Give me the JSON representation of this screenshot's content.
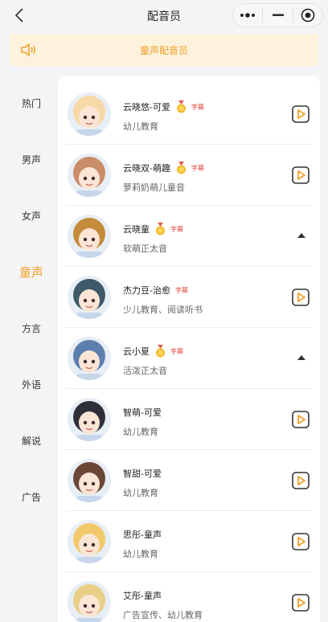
{
  "header": {
    "title": "配音员"
  },
  "banner": {
    "text": "童声配音员",
    "icon": "speaker-icon"
  },
  "sidebar": {
    "categories": [
      {
        "label": "热门"
      },
      {
        "label": "男声"
      },
      {
        "label": "女声"
      },
      {
        "label": "童声",
        "active": true
      },
      {
        "label": "方言"
      },
      {
        "label": "外语"
      },
      {
        "label": "解说"
      },
      {
        "label": "广告"
      }
    ]
  },
  "voices": [
    {
      "name": "云晓悠-可爱",
      "medal": true,
      "subtitle_badge": "字幕",
      "desc": "幼儿教育",
      "action": "play",
      "avatar_color": "#f6d9a6"
    },
    {
      "name": "云晓双-萌趣",
      "medal": true,
      "subtitle_badge": "字幕",
      "desc": "萝莉奶萌儿童音",
      "action": "play",
      "avatar_color": "#c98d68"
    },
    {
      "name": "云晓童",
      "medal": true,
      "subtitle_badge": "字幕",
      "desc": "软萌正太音",
      "action": "collapse",
      "avatar_color": "#c48b3a"
    },
    {
      "name": "杰力豆-治愈",
      "medal": false,
      "subtitle_badge": "字幕",
      "desc": "少儿教育、阅读听书",
      "action": "play",
      "avatar_color": "#3d5a6a"
    },
    {
      "name": "云小夏",
      "medal": true,
      "subtitle_badge": "字幕",
      "desc": "活泼正太音",
      "action": "collapse",
      "avatar_color": "#5d7fae"
    },
    {
      "name": "智萌-可爱",
      "medal": false,
      "subtitle_badge": "",
      "desc": "幼儿教育",
      "action": "play",
      "avatar_color": "#2f2f3a"
    },
    {
      "name": "智甜-可爱",
      "medal": false,
      "subtitle_badge": "",
      "desc": "幼儿教育",
      "action": "play",
      "avatar_color": "#6a4636"
    },
    {
      "name": "思彤-童声",
      "medal": false,
      "subtitle_badge": "",
      "desc": "幼儿教育",
      "action": "play",
      "avatar_color": "#f2c96a"
    },
    {
      "name": "艾彤-童声",
      "medal": false,
      "subtitle_badge": "",
      "desc": "广告宣传、幼儿教育",
      "action": "play",
      "avatar_color": "#e9cf88"
    }
  ],
  "colors": {
    "accent": "#f0a028",
    "badge": "#e0423a",
    "banner_bg": "#fdf3dd"
  }
}
